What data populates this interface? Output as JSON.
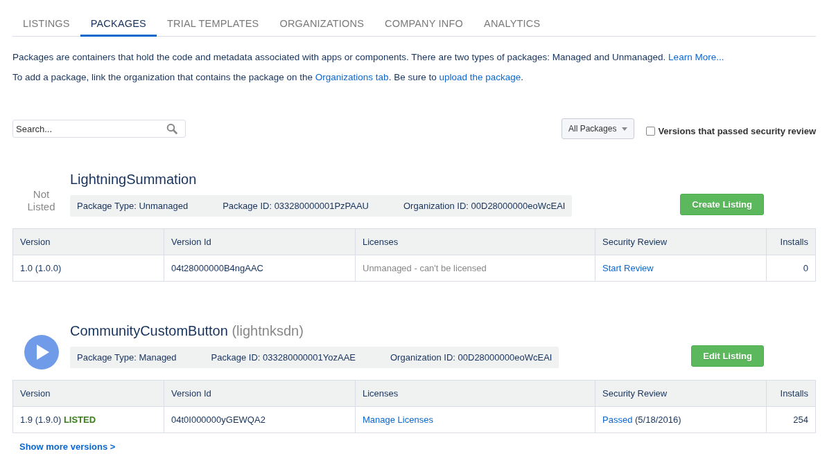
{
  "tabs": [
    {
      "label": "LISTINGS",
      "selected": false
    },
    {
      "label": "PACKAGES",
      "selected": true
    },
    {
      "label": "TRIAL TEMPLATES",
      "selected": false
    },
    {
      "label": "ORGANIZATIONS",
      "selected": false
    },
    {
      "label": "COMPANY INFO",
      "selected": false
    },
    {
      "label": "ANALYTICS",
      "selected": false
    }
  ],
  "intro": [
    [
      {
        "kind": "text",
        "text": "Packages are containers that hold the code and metadata associated with apps or components. There are two types of packages: Managed and Unmanaged. "
      },
      {
        "kind": "link",
        "text": "Learn More..."
      }
    ],
    [
      {
        "kind": "text",
        "text": "To add a package, link the organization that contains the package on the "
      },
      {
        "kind": "link",
        "text": "Organizations tab"
      },
      {
        "kind": "text",
        "text": ". Be sure to "
      },
      {
        "kind": "link",
        "text": "upload the package"
      },
      {
        "kind": "text",
        "text": "."
      }
    ]
  ],
  "search": {
    "placeholder": "Search..."
  },
  "filter": {
    "value": "All Packages"
  },
  "security_filter": {
    "label": "Versions that passed security review",
    "checked": false
  },
  "packages": [
    {
      "status": {
        "kind": "text",
        "text": "Not Listed"
      },
      "name": "LightningSummation",
      "info": [
        "Package Type: Unmanaged",
        "Package ID: 033280000001PzPAAU",
        "Organization ID: 00D28000000eoWcEAI"
      ],
      "button": "Create Listing",
      "columns": [
        "Version",
        "Version Id",
        "Licenses",
        "Security Review",
        "Installs"
      ],
      "rows": [
        {
          "version": "1.0 (1.0.0)",
          "version_id": "04t28000000B4ngAAC",
          "licenses": {
            "kind": "muted",
            "text": "Unmanaged - can't be licensed"
          },
          "security_review": {
            "link": "Start Review"
          },
          "installs": "0"
        }
      ]
    },
    {
      "status": {
        "kind": "play"
      },
      "name": "CommunityCustomButton",
      "namespace": "(lightnksdn)",
      "info": [
        "Package Type: Managed",
        "Package ID: 033280000001YozAAE",
        "Organization ID: 00D28000000eoWcEAI"
      ],
      "button": "Edit Listing",
      "columns": [
        "Version",
        "Version Id",
        "Licenses",
        "Security Review",
        "Installs"
      ],
      "rows": [
        {
          "version": "1.9 (1.9.0)",
          "badge": "LISTED",
          "version_id": "04t0I000000yGEWQA2",
          "licenses": {
            "kind": "link",
            "text": "Manage Licenses"
          },
          "security_review": {
            "link": "Passed",
            "note": "(5/18/2016)"
          },
          "installs": "254"
        }
      ],
      "more": "Show more versions >"
    }
  ]
}
